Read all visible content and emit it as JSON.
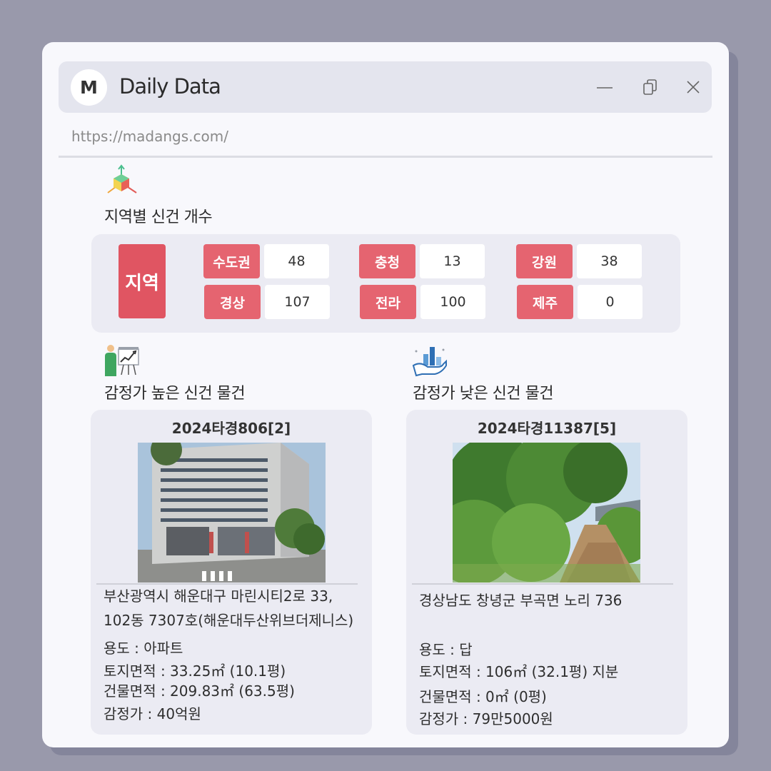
{
  "window": {
    "logo_letter": "M",
    "title": "Daily Data",
    "url": "https://madangs.com/"
  },
  "region_section": {
    "title": "지역별 신건 개수",
    "label": "지역",
    "regions": [
      {
        "name": "수도권",
        "count": "48"
      },
      {
        "name": "충청",
        "count": "13"
      },
      {
        "name": "강원",
        "count": "38"
      },
      {
        "name": "경상",
        "count": "107"
      },
      {
        "name": "전라",
        "count": "100"
      },
      {
        "name": "제주",
        "count": "0"
      }
    ]
  },
  "high_section": {
    "title": "감정가 높은 신건 물건",
    "case_no": "2024타경806[2]",
    "address_line1": "부산광역시 해운대구 마린시티2로 33,",
    "address_line2": "102동 7307호(해운대두산위브더제니스)",
    "usage": "용도 : 아파트",
    "land_area": "토지면적 : 33.25㎡ (10.1평)",
    "building_area": "건물면적 : 209.83㎡ (63.5평)",
    "appraisal": "감정가 : 40억원"
  },
  "low_section": {
    "title": "감정가 낮은 신건 물건",
    "case_no": "2024타경11387[5]",
    "address_line1": "경상남도 창녕군 부곡면 노리 736",
    "usage": "용도 : 답",
    "land_area": "토지면적 : 106㎡ (32.1평) 지분",
    "building_area": "건물면적 : 0㎡ (0평)",
    "appraisal": "감정가 : 79만5000원"
  },
  "colors": {
    "accent": "#e56470",
    "accent_dark": "#e05562",
    "panel": "#ebebf3",
    "background": "#9999ab"
  },
  "icons": [
    "cube-arrows-icon",
    "presentation-chart-icon",
    "hand-bar-chart-icon",
    "minimize-icon",
    "copy-icon",
    "close-icon"
  ]
}
